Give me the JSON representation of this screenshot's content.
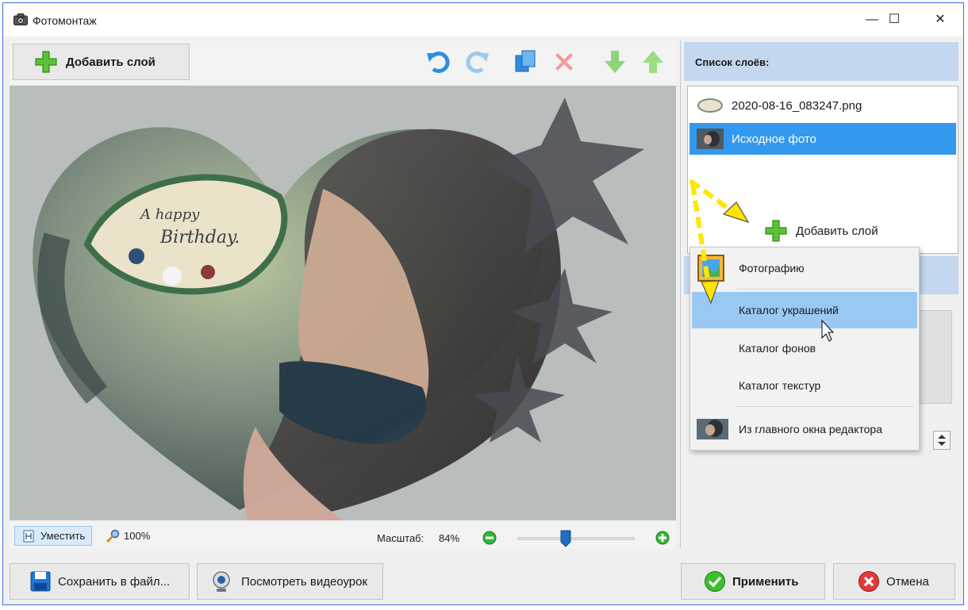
{
  "window": {
    "title": "Фотомонтаж",
    "minimize": "—",
    "maximize": "☐",
    "close": "✕"
  },
  "toolbar": {
    "add_layer_label": "Добавить слой"
  },
  "canvas": {
    "card_text_line1": "A happy",
    "card_text_line2": "Birthday."
  },
  "statusbar": {
    "fit_label": "Уместить",
    "zoom100_label": "100%",
    "scale_label": "Масштаб:",
    "scale_value": "84%",
    "scale_percent": 84
  },
  "layers_panel": {
    "header": "Список слоёв:",
    "items": [
      {
        "name": "2020-08-16_083247.png",
        "selected": false
      },
      {
        "name": "Исходное фото",
        "selected": true
      }
    ],
    "add_label": "Добавить слой"
  },
  "context_menu": {
    "items": [
      {
        "label": "Фотографию",
        "highlighted": false
      },
      {
        "label": "Каталог украшений",
        "highlighted": true
      },
      {
        "label": "Каталог фонов",
        "highlighted": false
      },
      {
        "label": "Каталог текстур",
        "highlighted": false
      },
      {
        "label": "Из главного окна редактора",
        "highlighted": false
      }
    ]
  },
  "footer": {
    "save_label": "Сохранить в файл...",
    "video_label": "Посмотреть видеоурок",
    "apply_label": "Применить",
    "cancel_label": "Отмена"
  },
  "colors": {
    "accent": "#3399ee",
    "highlight": "#99c9f3",
    "panel_header": "#c3d7ee",
    "arrow": "#ffe600",
    "window_border": "#3b6fd8"
  }
}
